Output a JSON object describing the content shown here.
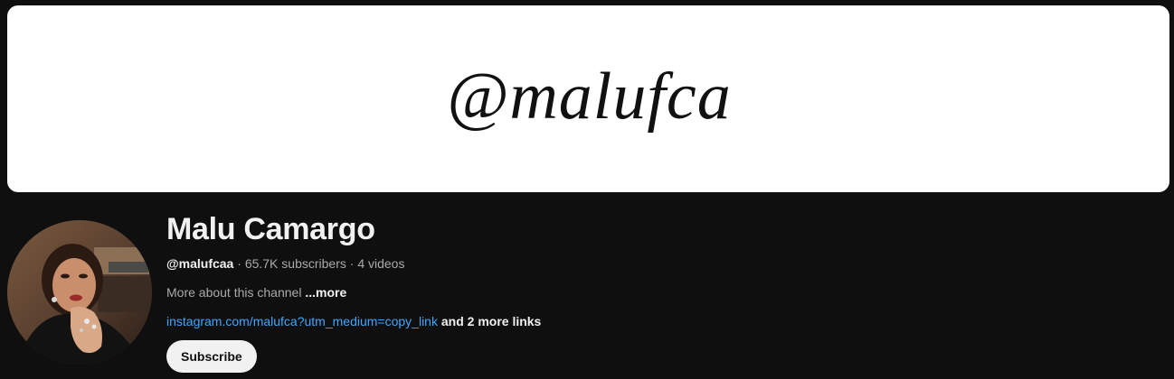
{
  "banner": {
    "text": "@malufca"
  },
  "channel": {
    "name": "Malu Camargo",
    "handle": "@malufcaa",
    "separator": " · ",
    "subscribers": "65.7K subscribers",
    "videos": "4 videos",
    "about_text": "More about this channel",
    "about_more": "...more",
    "link_text": "instagram.com/malufca?utm_medium=copy_link",
    "more_links": "and 2 more links"
  },
  "actions": {
    "subscribe_label": "Subscribe"
  },
  "colors": {
    "background": "#0f0f0f",
    "link": "#3ea6ff",
    "button_bg": "#f1f1f1"
  }
}
